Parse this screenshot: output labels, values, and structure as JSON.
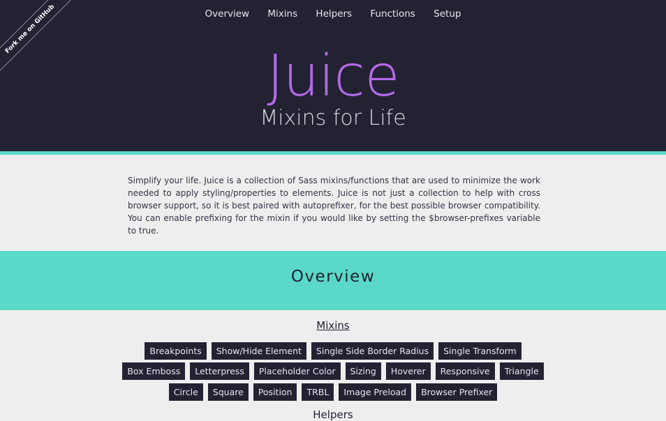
{
  "nav": {
    "items": [
      "Overview",
      "Mixins",
      "Helpers",
      "Functions",
      "Setup"
    ]
  },
  "ribbon": {
    "label": "Fork me on GitHub"
  },
  "hero": {
    "title": "Juice",
    "subtitle": "Mixins for Life"
  },
  "intro": {
    "text": "Simplify your life. Juice is a collection of Sass mixins/functions that are used to minimize the work needed to apply styling/properties to elements. Juice is not just a collection to help with cross browser support, so it is best paired with autoprefixer, for the best possible browser compatibility. You can enable prefixing for the mixin if you would like by setting the $browser-prefixes variable to true."
  },
  "overview": {
    "title": "Overview"
  },
  "mixins": {
    "heading": "Mixins",
    "row1": [
      "Breakpoints",
      "Show/Hide Element",
      "Single Side Border Radius",
      "Single Transform"
    ],
    "row2": [
      "Box Emboss",
      "Letterpress",
      "Placeholder Color",
      "Sizing",
      "Hoverer",
      "Responsive",
      "Triangle"
    ],
    "row3": [
      "Circle",
      "Square",
      "Position",
      "TRBL",
      "Image Preload",
      "Browser Prefixer"
    ]
  },
  "helpers": {
    "heading": "Helpers"
  },
  "colors": {
    "header_bg": "#222233",
    "accent_teal": "#5ad8c8",
    "title_purple": "#b469e8",
    "page_bg": "#eeeeee"
  }
}
